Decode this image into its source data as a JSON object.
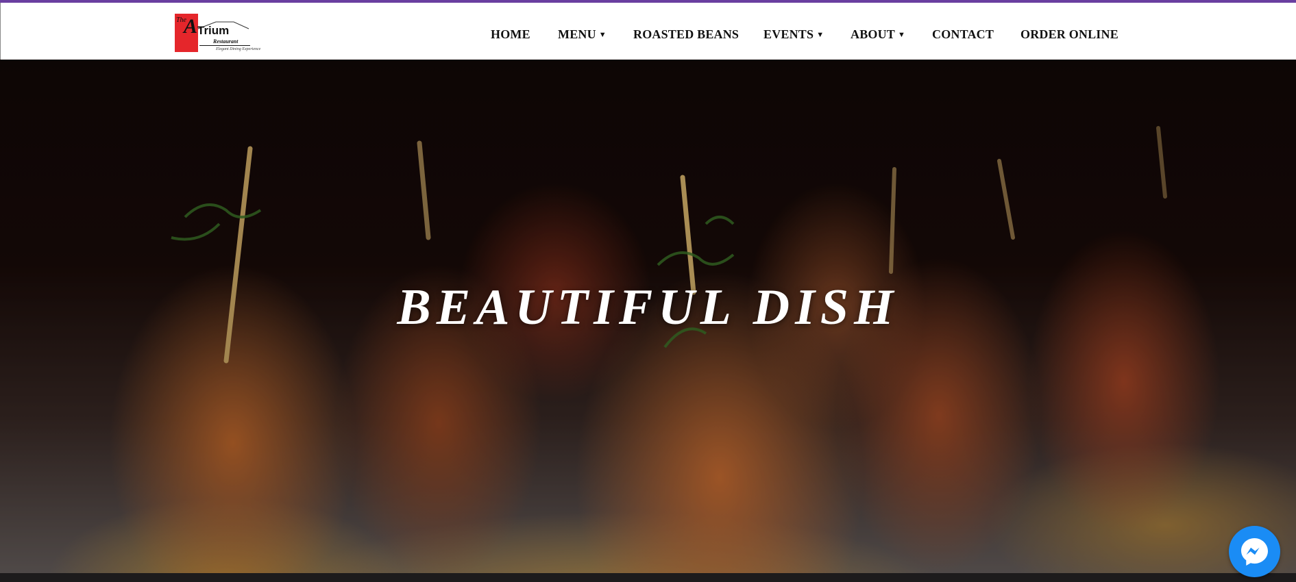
{
  "brand": {
    "logo_the": "The",
    "logo_a": "A",
    "logo_word": "Trium",
    "logo_restaurant": "Restaurant",
    "logo_tagline": "Elegant Dining Experience",
    "accent_color": "#6a3fa0",
    "logo_red": "#e5262b"
  },
  "nav": {
    "items": [
      {
        "label": "HOME",
        "has_dropdown": false
      },
      {
        "label": "MENU",
        "has_dropdown": true
      },
      {
        "label": "ROASTED BEANS",
        "has_dropdown": false
      },
      {
        "label": "EVENTS",
        "has_dropdown": true
      },
      {
        "label": "ABOUT",
        "has_dropdown": true
      },
      {
        "label": "CONTACT",
        "has_dropdown": false
      },
      {
        "label": "ORDER ONLINE",
        "has_dropdown": false
      }
    ],
    "caret": "▼"
  },
  "hero": {
    "title": "BEAUTIFUL DISH"
  },
  "messenger": {
    "icon": "messenger-icon",
    "color": "#1a8cf5"
  }
}
